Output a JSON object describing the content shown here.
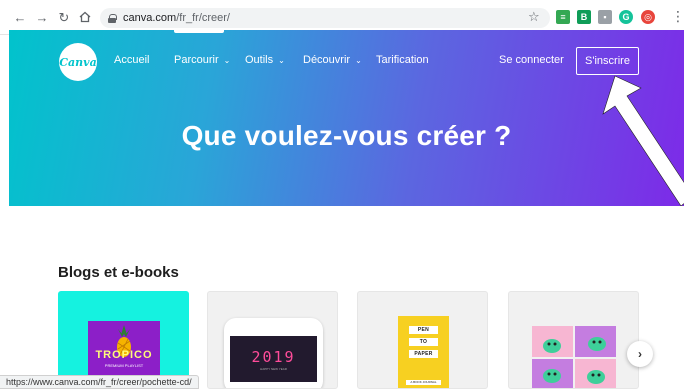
{
  "browser": {
    "url_host": "canva.com",
    "url_path": "/fr_fr/creer/",
    "status_url": "https://www.canva.com/fr_fr/creer/pochette-cd/",
    "extensions": [
      {
        "name": "sheets-extension-icon",
        "color": "#34a853",
        "glyph": "≡"
      },
      {
        "name": "b-extension-icon",
        "color": "#0f9d58",
        "glyph": "B"
      },
      {
        "name": "chat-extension-icon",
        "color": "#9aa0a6",
        "glyph": "▪"
      },
      {
        "name": "grammarly-extension-icon",
        "color": "#15c39a",
        "glyph": "G"
      },
      {
        "name": "alert-extension-icon",
        "color": "#e8453c",
        "glyph": "◎"
      }
    ]
  },
  "header": {
    "logo_text": "Canva",
    "nav": [
      {
        "label": "Accueil"
      },
      {
        "label": "Parcourir"
      },
      {
        "label": "Outils"
      },
      {
        "label": "Découvrir"
      },
      {
        "label": "Tarification"
      }
    ],
    "signin_label": "Se connecter",
    "signup_label": "S'inscrire"
  },
  "hero": {
    "headline": "Que voulez-vous créer ?"
  },
  "section": {
    "title": "Blogs et e-books",
    "cards": [
      {
        "title": "TROPICO",
        "subtitle": "PREMIUM PLAYLIST"
      },
      {
        "title": "2019",
        "subtitle": "HAPPY NEW YEAR"
      },
      {
        "tags": [
          "PEN",
          "TO",
          "PAPER"
        ],
        "subtitle": "A BOOK JOURNAL"
      },
      {
        "title": ""
      }
    ]
  },
  "colors": {
    "hero_start": "#01c3cc",
    "hero_end": "#7d2ae8",
    "canva_teal": "#00c4cc"
  }
}
